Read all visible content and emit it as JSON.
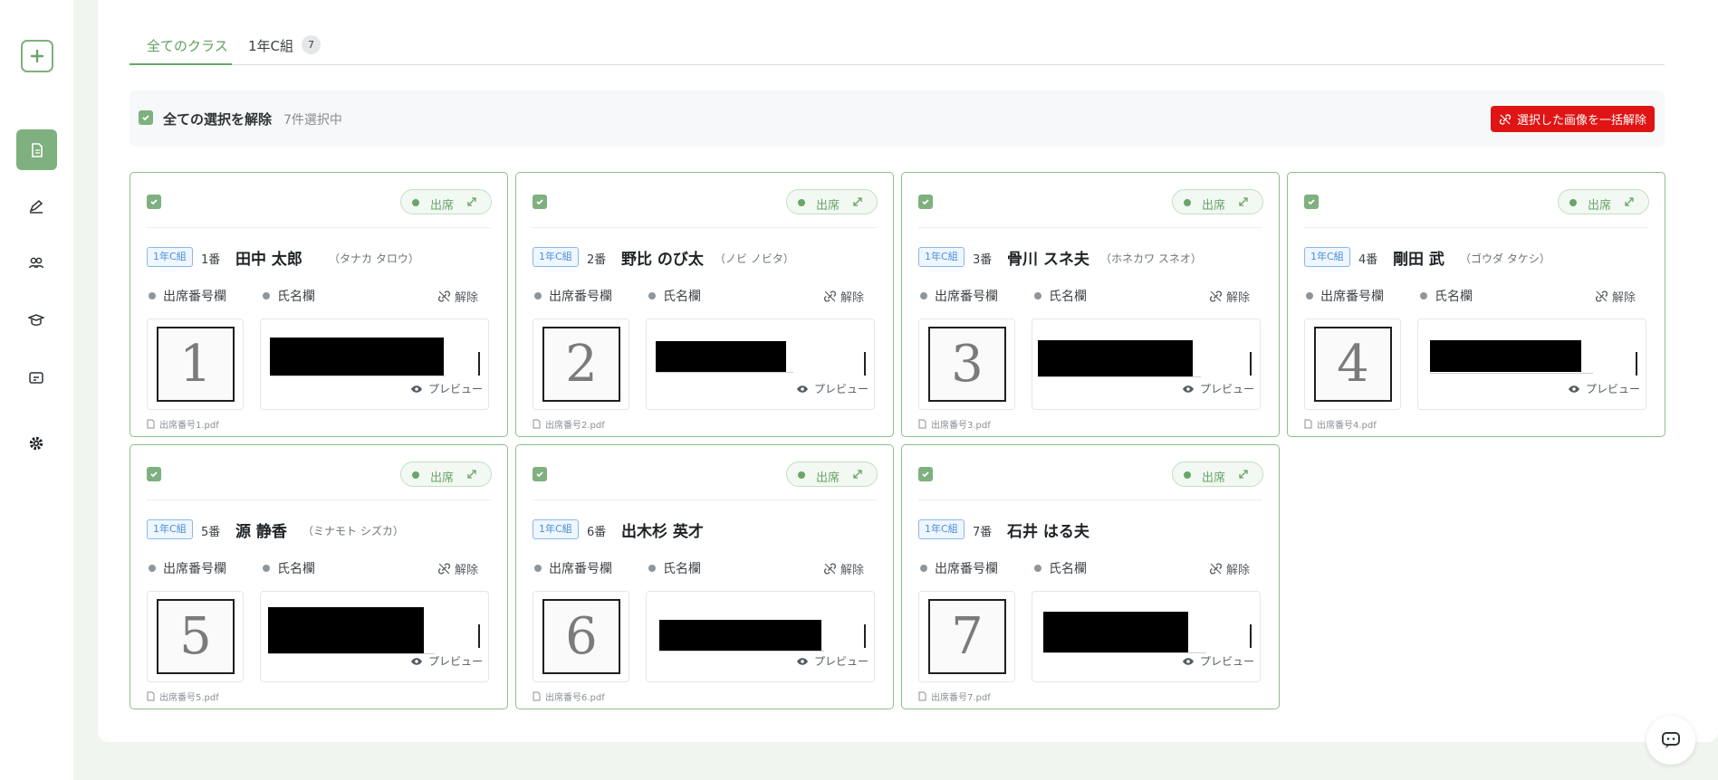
{
  "sidebar": {
    "items": [
      {
        "name": "add",
        "icon": "plus-square-icon"
      },
      {
        "name": "documents",
        "icon": "document-icon",
        "active": true
      },
      {
        "name": "grading",
        "icon": "pen-icon"
      },
      {
        "name": "students",
        "icon": "people-icon"
      },
      {
        "name": "graduation",
        "icon": "graduation-cap-icon"
      },
      {
        "name": "classroom",
        "icon": "classroom-icon"
      },
      {
        "name": "settings",
        "icon": "gear-icon"
      }
    ]
  },
  "tabs": [
    {
      "label": "全てのクラス",
      "active": true
    },
    {
      "label": "1年C組",
      "count": "7"
    }
  ],
  "selection": {
    "label": "全ての選択を解除",
    "count_text": "7件選択中",
    "bulk_button": "選択した画像を一括解除"
  },
  "labels": {
    "status": "出席",
    "seat_field": "出席番号欄",
    "name_field": "氏名欄",
    "unlink": "解除",
    "preview": "プレビュー"
  },
  "students": [
    {
      "class": "1年C組",
      "seat": "1番",
      "name": "田中 太郎",
      "kana": "（タナカ タロウ）",
      "digit": "1",
      "file": "出席番号1.pdf"
    },
    {
      "class": "1年C組",
      "seat": "2番",
      "name": "野比 のび太",
      "kana": "（ノビ ノビタ）",
      "digit": "2",
      "file": "出席番号2.pdf"
    },
    {
      "class": "1年C組",
      "seat": "3番",
      "name": "骨川 スネ夫",
      "kana": "（ホネカワ スネオ）",
      "digit": "3",
      "file": "出席番号3.pdf"
    },
    {
      "class": "1年C組",
      "seat": "4番",
      "name": "剛田 武",
      "kana": "（ゴウダ タケシ）",
      "digit": "4",
      "file": "出席番号4.pdf"
    },
    {
      "class": "1年C組",
      "seat": "5番",
      "name": "源 静香",
      "kana": "（ミナモト シズカ）",
      "digit": "5",
      "file": "出席番号5.pdf"
    },
    {
      "class": "1年C組",
      "seat": "6番",
      "name": "出木杉 英才",
      "kana": "",
      "digit": "6",
      "file": "出席番号6.pdf"
    },
    {
      "class": "1年C組",
      "seat": "7番",
      "name": "石井 はる夫",
      "kana": "",
      "digit": "7",
      "file": "出席番号7.pdf"
    }
  ],
  "colors": {
    "accent": "#7fb07f",
    "danger": "#e01414",
    "class_badge": "#4b8fd6"
  }
}
